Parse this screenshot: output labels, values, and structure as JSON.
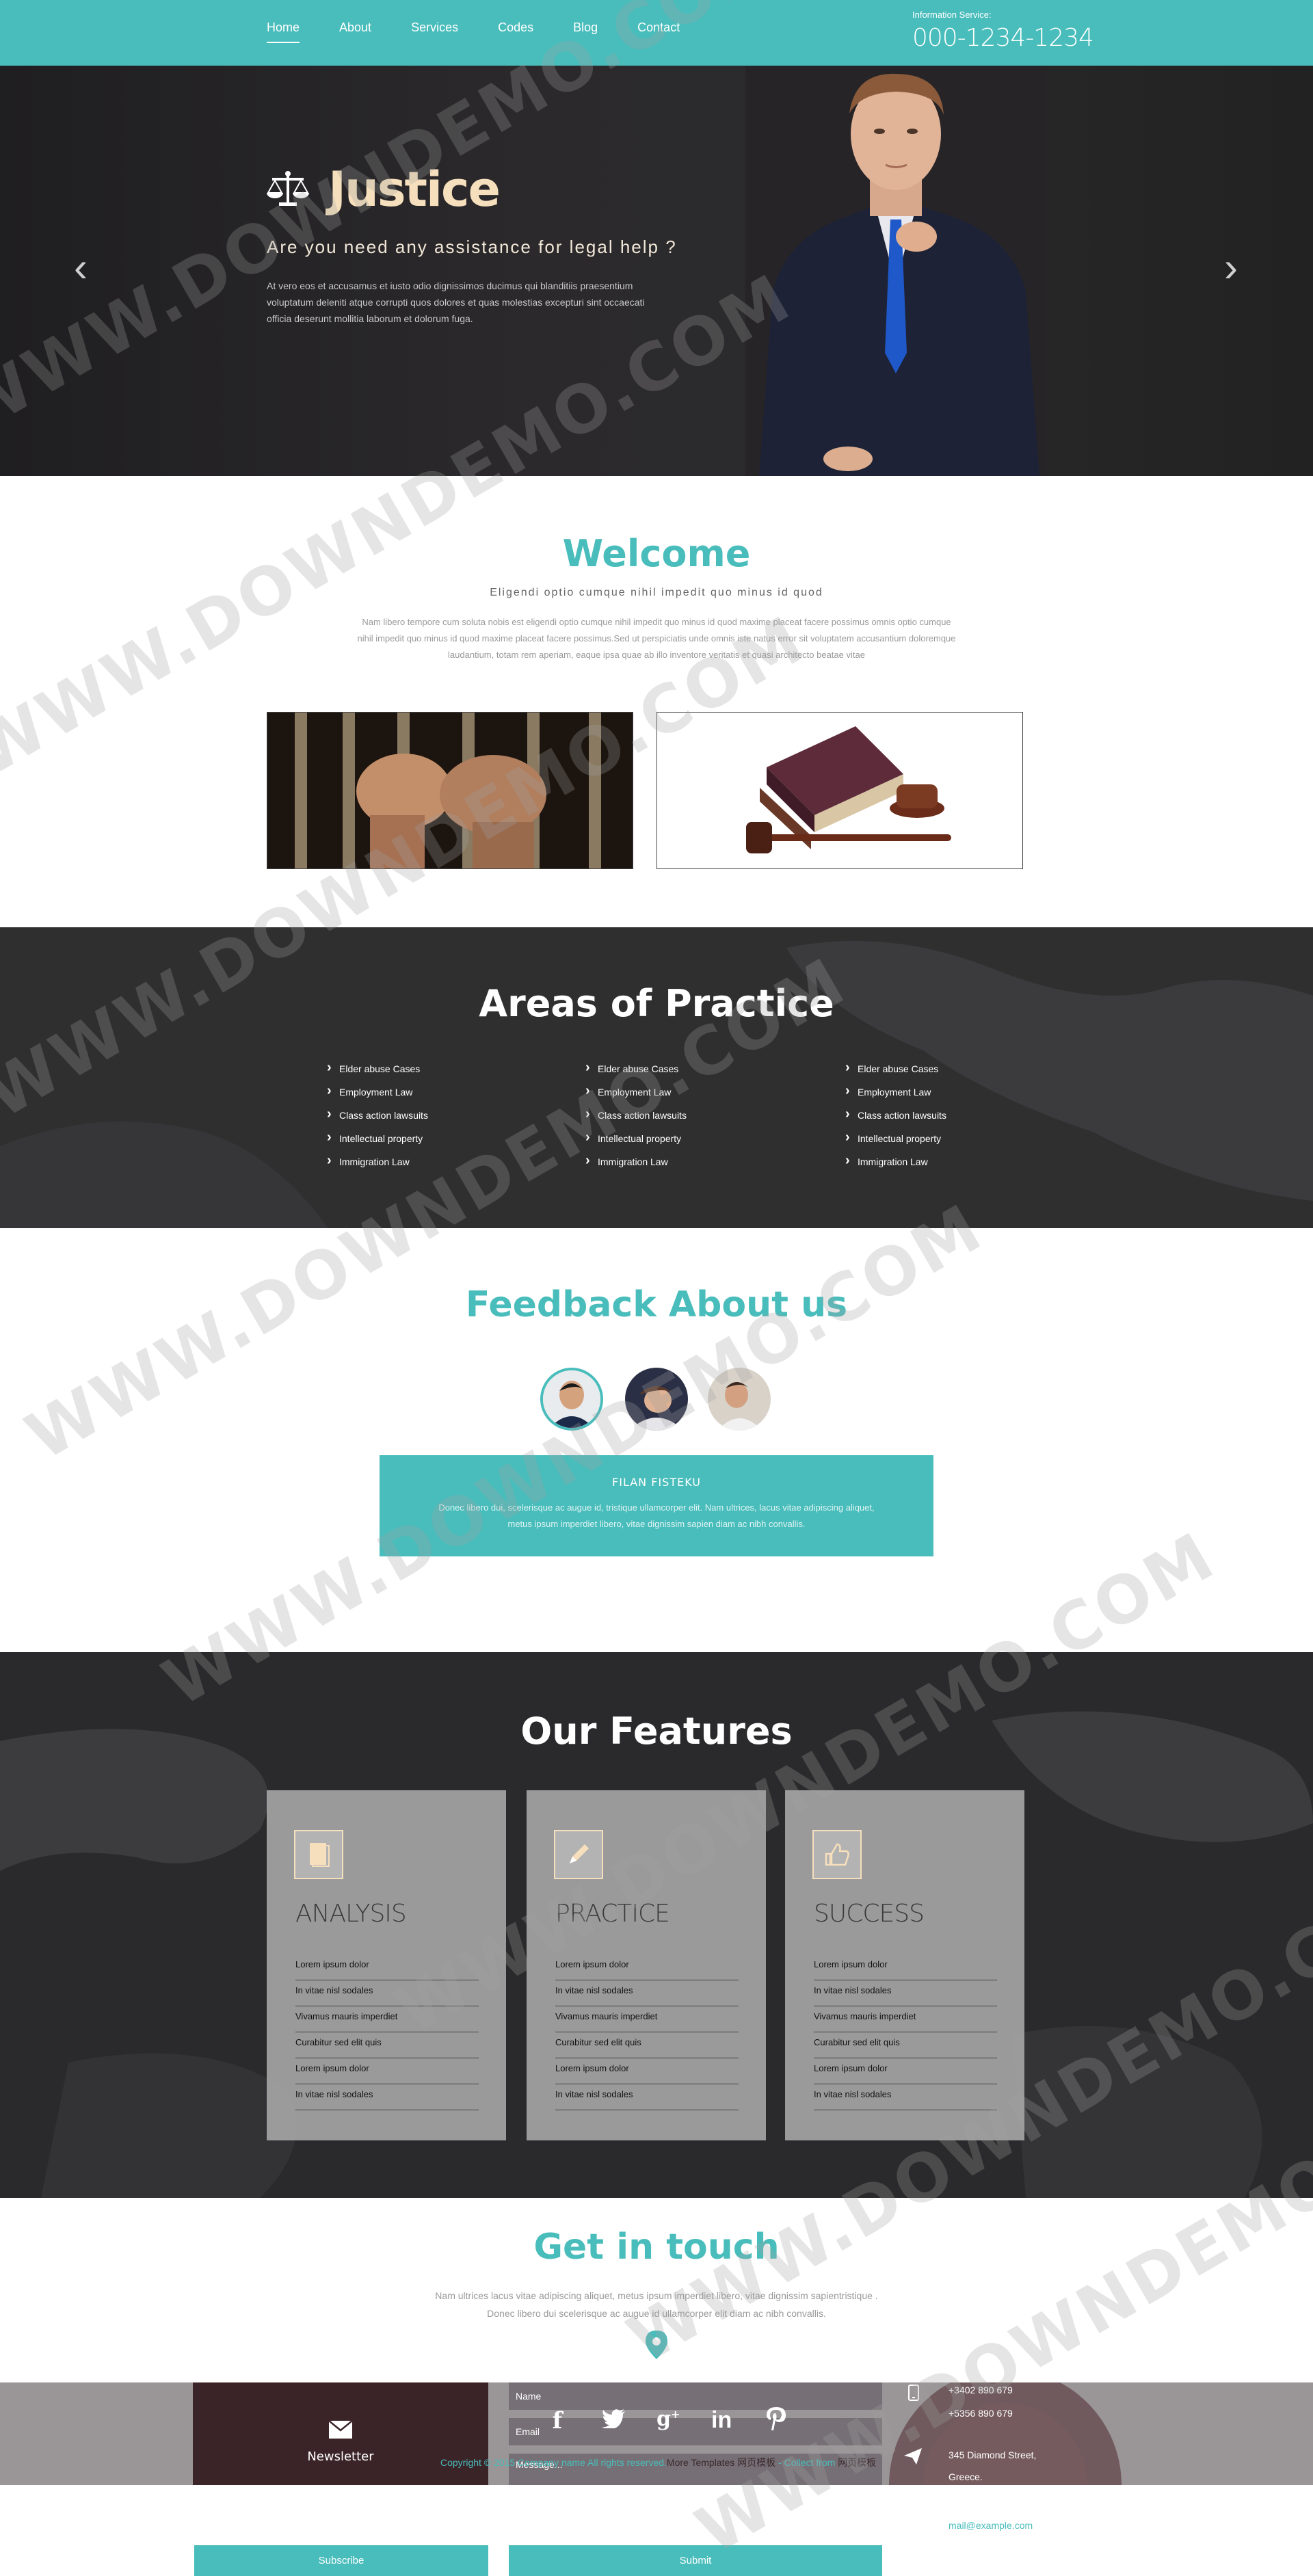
{
  "nav": {
    "items": [
      "Home",
      "About",
      "Services",
      "Codes",
      "Blog",
      "Contact"
    ],
    "active_index": 0
  },
  "header": {
    "info_label": "Information Service:",
    "phone": "000-1234-1234"
  },
  "hero": {
    "title": "Justice",
    "subtitle": "Are you need any assistance for legal help ?",
    "text": "At vero eos et accusamus et iusto odio dignissimos ducimus qui blanditiis praesentium voluptatum deleniti atque corrupti quos dolores et quas molestias excepturi sint occaecati officia deserunt mollitia laborum et dolorum fuga."
  },
  "welcome": {
    "title": "Welcome",
    "subtitle": "Eligendi optio cumque nihil impedit quo minus id quod",
    "text": "Nam libero tempore cum soluta nobis est eligendi optio cumque nihil impedit quo minus id quod maxime placeat facere possimus omnis optio cumque nihil impedit quo minus id quod maxime placeat facere possimus.Sed ut perspiciatis unde omnis iste natus error sit voluptatem accusantium doloremque laudantium, totam rem aperiam, eaque ipsa quae ab illo inventore veritatis et quasi architecto beatae vitae"
  },
  "areas": {
    "title": "Areas of Practice",
    "columns": [
      [
        "Elder abuse Cases",
        "Employment Law",
        "Class action lawsuits",
        "Intellectual property",
        "Immigration Law"
      ],
      [
        "Elder abuse Cases",
        "Employment Law",
        "Class action lawsuits",
        "Intellectual property",
        "Immigration Law"
      ],
      [
        "Elder abuse Cases",
        "Employment Law",
        "Class action lawsuits",
        "Intellectual property",
        "Immigration Law"
      ]
    ]
  },
  "feedback": {
    "title": "Feedback About us",
    "name": "FILAN FISTEKU",
    "text": "Donec libero dui, scelerisque ac augue id, tristique ullamcorper elit. Nam ultrices, lacus vitae adipiscing aliquet, metus ipsum imperdiet libero, vitae dignissim sapien diam ac nibh convallis."
  },
  "features": {
    "title": "Our Features",
    "cards": [
      {
        "title": "ANALYSIS",
        "icon": "book-icon",
        "items": [
          "Lorem ipsum dolor",
          "In vitae nisl sodales",
          "Vivamus mauris imperdiet",
          "Curabitur sed elit quis",
          "Lorem ipsum dolor",
          "In vitae nisl sodales"
        ]
      },
      {
        "title": "PRACTICE",
        "icon": "pencil-icon",
        "items": [
          "Lorem ipsum dolor",
          "In vitae nisl sodales",
          "Vivamus mauris imperdiet",
          "Curabitur sed elit quis",
          "Lorem ipsum dolor",
          "In vitae nisl sodales"
        ]
      },
      {
        "title": "SUCCESS",
        "icon": "thumbs-up-icon",
        "items": [
          "Lorem ipsum dolor",
          "In vitae nisl sodales",
          "Vivamus mauris imperdiet",
          "Curabitur sed elit quis",
          "Lorem ipsum dolor",
          "In vitae nisl sodales"
        ]
      }
    ]
  },
  "contact": {
    "title": "Get in touch",
    "text": "Nam ultrices lacus vitae adipiscing aliquet, metus ipsum imperdiet libero, vitae dignissim sapientristique . Donec libero dui scelerisque ac augue id ullamcorper elit diam ac nibh convallis.",
    "newsletter_label": "Newsletter",
    "name_placeholder": "Name",
    "email_placeholder": "Email",
    "message_placeholder": "Message...",
    "copyright_prefix": "Copyright © 2015 Company name All rights reserved.",
    "copyright_link1": "More Templates",
    "copyright_link1_cn": "网页模板",
    "copyright_mid": " - Collect from ",
    "copyright_link2": "网页模板",
    "phone1": "+3402 890 679",
    "phone2": "+5356 890 679",
    "address_line1": "345 Diamond Street,",
    "address_line2": "Greece.",
    "email": "mail@example.com",
    "subscribe_label": "Subscribe",
    "submit_label": "Submit"
  },
  "watermark": "WWW.DOWNDEMO.COM",
  "colors": {
    "accent": "#49bdbb",
    "dark": "#2f2f30",
    "hero_title": "#f6dfbc"
  }
}
